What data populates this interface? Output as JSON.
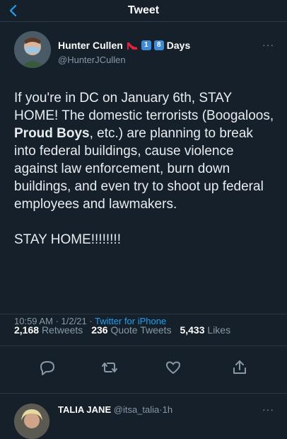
{
  "header": {
    "title": "Tweet"
  },
  "tweet": {
    "author_name": "Hunter Cullen",
    "badge_1": "1",
    "badge_2": "8",
    "badge_suffix": "Days",
    "author_handle": "@HunterJCullen",
    "text_before_bold": "If you're in DC on January 6th, STAY HOME! The domestic terrorists (Boogaloos, ",
    "text_bold": "Proud Boys",
    "text_after_bold": ", etc.) are planning to break into federal buildings, cause violence against law enforcement, burn down buildings, and even try to shoot up federal employees and lawmakers.",
    "text_line2": "STAY HOME!!!!!!!!",
    "time": "10:59 AM",
    "date": "1/2/21",
    "separator": "·",
    "source": "Twitter for iPhone",
    "stats": {
      "retweets_count": "2,168",
      "retweets_label": "Retweets",
      "quotes_count": "236",
      "quotes_label": "Quote Tweets",
      "likes_count": "5,433",
      "likes_label": "Likes"
    }
  },
  "reply": {
    "name": "TALIA JANE",
    "handle": "@itsa_talia",
    "time": "1h"
  },
  "colors": {
    "background": "#15202b",
    "accent": "#1da1f2",
    "secondary_text": "#8899a6"
  }
}
